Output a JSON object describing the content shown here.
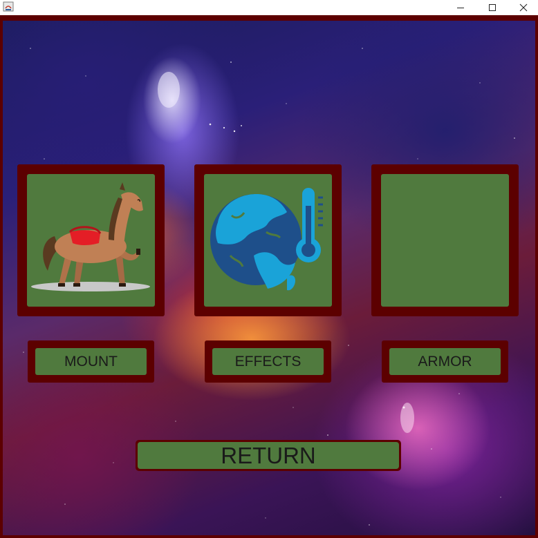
{
  "window": {
    "controls": {
      "minimize_icon": "minimize-icon",
      "maximize_icon": "maximize-icon",
      "close_icon": "close-icon"
    },
    "app_icon": "java-app-icon"
  },
  "colors": {
    "frame": "#5c0000",
    "panel_fill": "#507a3e",
    "text": "#1a1a1a"
  },
  "panels": [
    {
      "icon": "horse-icon"
    },
    {
      "icon": "globe-thermometer-icon"
    },
    {
      "icon": ""
    }
  ],
  "buttons": {
    "mount": "MOUNT",
    "effects": "EFFECTS",
    "armor": "ARMOR",
    "return": "RETURN"
  }
}
